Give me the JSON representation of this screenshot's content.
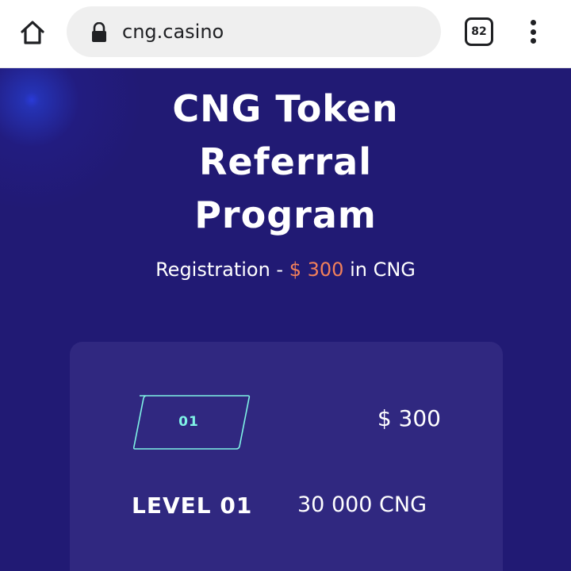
{
  "browser": {
    "url": "cng.casino",
    "tab_count": "82",
    "icons": {
      "home": "home-icon",
      "lock": "lock-icon",
      "menu": "more-vert-icon"
    }
  },
  "hero": {
    "title_lines": [
      "CNG Token",
      "Referral",
      "Program"
    ],
    "subtitle_prefix": "Registration - ",
    "subtitle_amount": "$ 300",
    "subtitle_suffix": " in CNG"
  },
  "level_card": {
    "badge": "01",
    "usd_amount": "$ 300",
    "level_label": "LEVEL 01",
    "cng_amount": "30 000 CNG"
  },
  "colors": {
    "page_background": "#211a74",
    "card_background": "#302880",
    "accent_orange": "#f2805a",
    "badge_teal": "#7ff3e6"
  }
}
